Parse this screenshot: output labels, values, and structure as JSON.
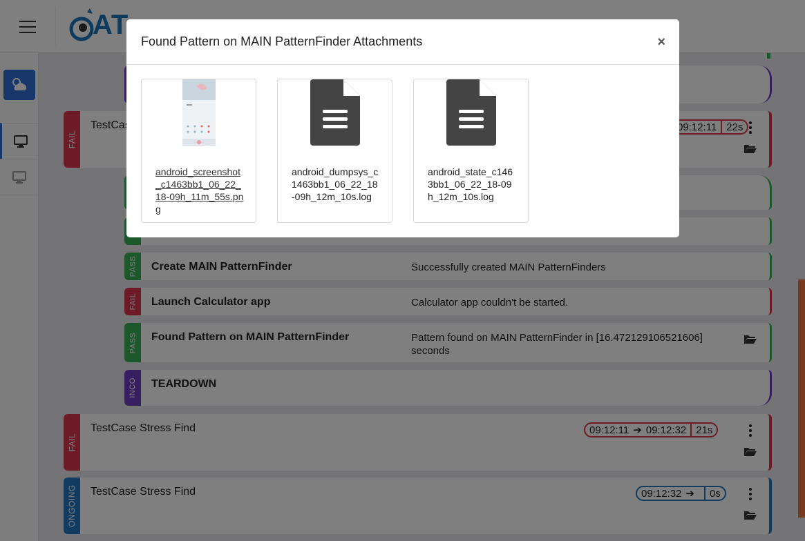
{
  "app": {
    "logo_text": "AT"
  },
  "colors": {
    "fail": "#d9374f",
    "pass": "#3aae58",
    "inco": "#6b3fc0",
    "ongoing": "#2476c3",
    "accent": "#2f6fd6"
  },
  "testcases": [
    {
      "status": "FAIL",
      "title": "TestCase Stress Find",
      "start": "09:12:11",
      "end": "",
      "duration": "22s"
    },
    {
      "status": "FAIL",
      "title": "TestCase Stress Find",
      "start": "09:12:11",
      "end": "09:12:32",
      "duration": "21s"
    },
    {
      "status": "ONGOING",
      "title": "TestCase Stress Find",
      "start": "09:12:32",
      "end": "",
      "duration": "0s"
    }
  ],
  "steps": [
    {
      "status": "PASS",
      "title": "Create MAIN PatternFinder",
      "message": "Successfully created MAIN PatternFinders"
    },
    {
      "status": "FAIL",
      "title": "Launch Calculator app",
      "message": "Calculator app couldn't be started."
    },
    {
      "status": "PASS",
      "title": "Found Pattern on MAIN PatternFinder",
      "message": "Pattern found on MAIN PatternFinder in [16.472129106521606] seconds"
    },
    {
      "status": "INCO",
      "title": "TEARDOWN",
      "message": ""
    }
  ],
  "modal": {
    "title": "Found Pattern on MAIN PatternFinder Attachments",
    "close_label": "×",
    "attachments": [
      {
        "name": "android_screenshot_c1463bb1_06_22_18-09h_11m_55s.png",
        "kind": "image"
      },
      {
        "name": "android_dumpsys_c1463bb1_06_22_18-09h_12m_10s.log",
        "kind": "file"
      },
      {
        "name": "android_state_c1463bb1_06_22_18-09h_12m_10s.log",
        "kind": "file"
      }
    ]
  }
}
